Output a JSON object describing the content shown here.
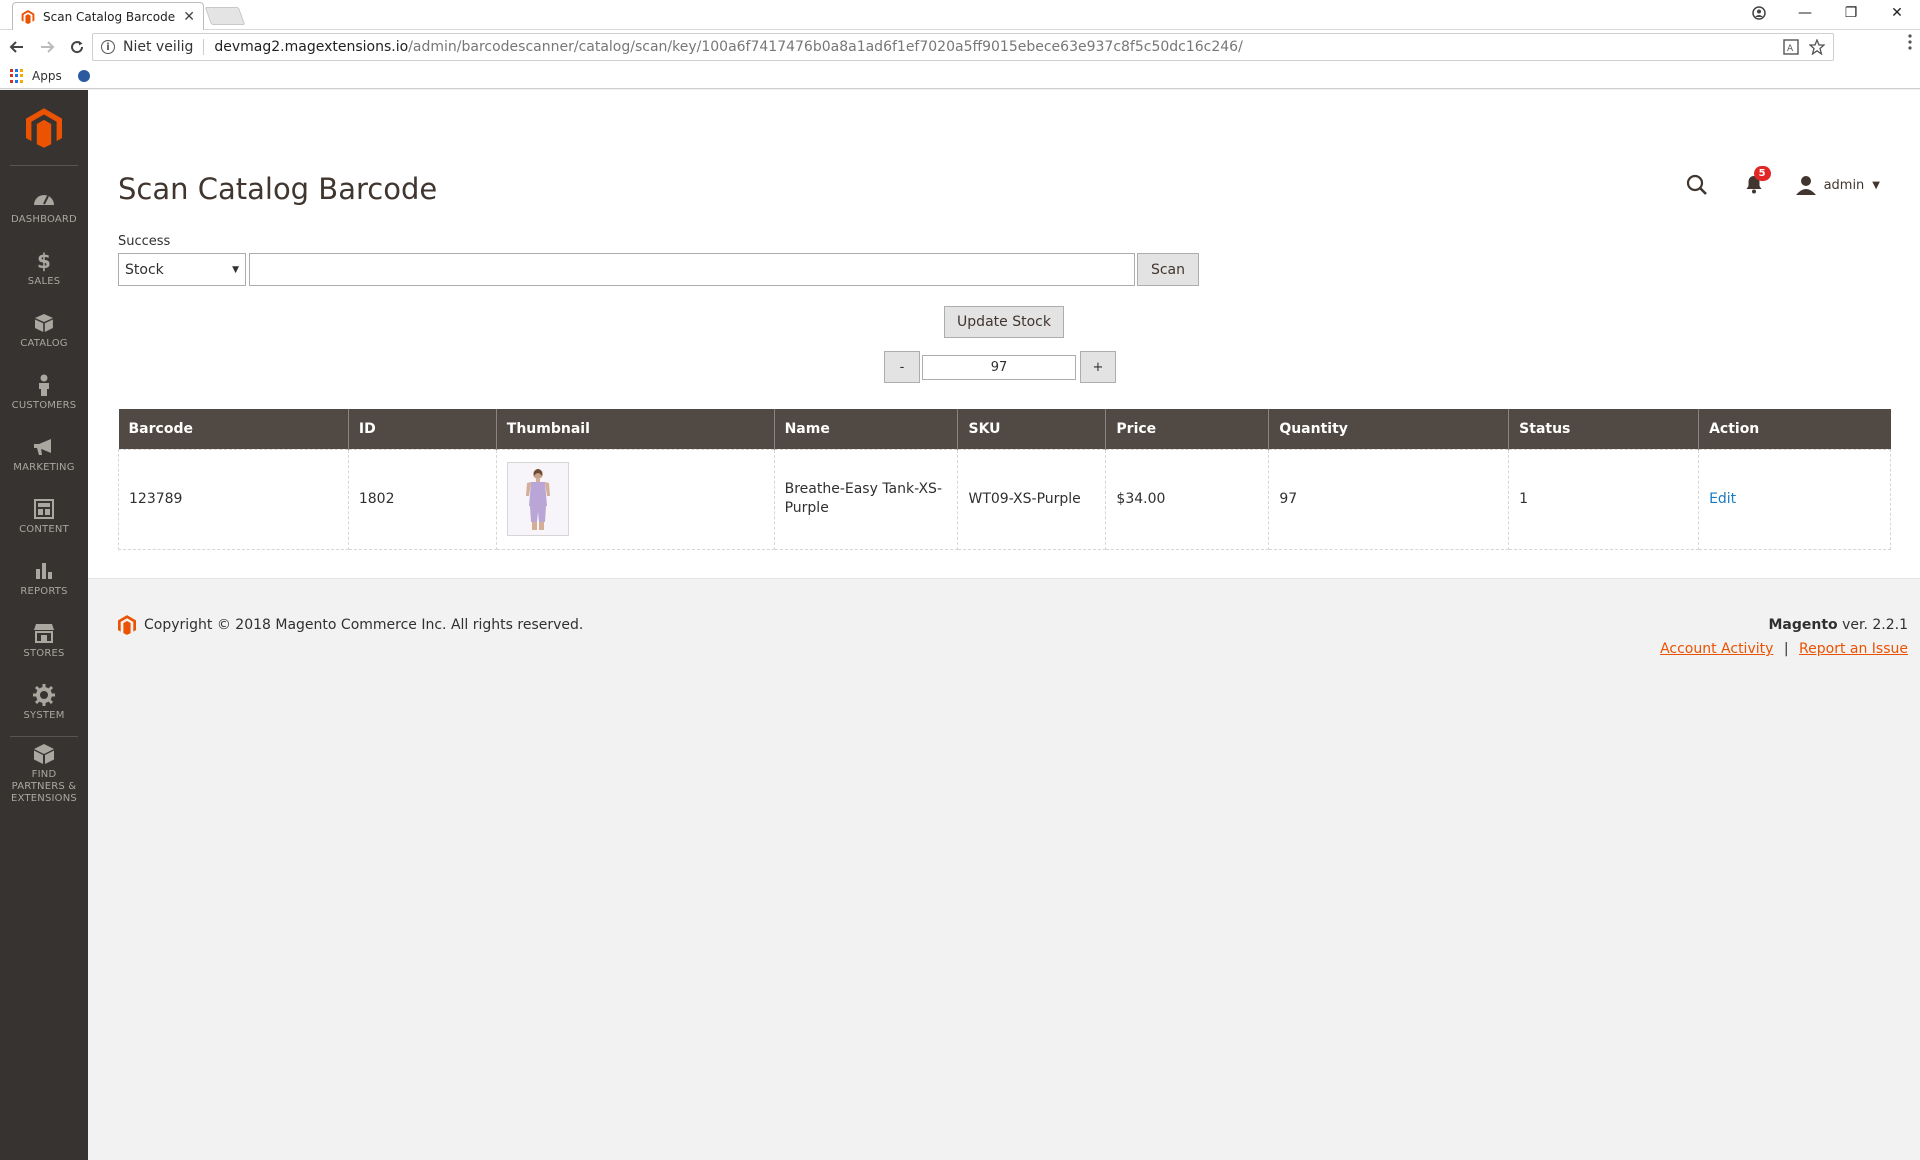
{
  "browser": {
    "tab_title": "Scan Catalog Barcode",
    "tab_close": "✕",
    "security_label": "Niet veilig",
    "url_domain": "devmag2.magextensions.io",
    "url_path": "/admin/barcodescanner/catalog/scan/key/100a6f7417476b0a8a1ad6f1ef7020a5ff9015ebece63e937c8f5c50dc16c246/",
    "bookmark_apps": "Apps",
    "win_minimize": "—",
    "win_restore": "❐",
    "win_close": "✕"
  },
  "sidebar": {
    "items": [
      {
        "label": "DASHBOARD",
        "icon": "dashboard-icon"
      },
      {
        "label": "SALES",
        "icon": "dollar-icon"
      },
      {
        "label": "CATALOG",
        "icon": "box-icon"
      },
      {
        "label": "CUSTOMERS",
        "icon": "person-icon"
      },
      {
        "label": "MARKETING",
        "icon": "megaphone-icon"
      },
      {
        "label": "CONTENT",
        "icon": "layout-icon"
      },
      {
        "label": "REPORTS",
        "icon": "bar-chart-icon"
      },
      {
        "label": "STORES",
        "icon": "store-icon"
      },
      {
        "label": "SYSTEM",
        "icon": "gear-icon"
      },
      {
        "label": "FIND PARTNERS & EXTENSIONS",
        "icon": "cube-icon"
      }
    ]
  },
  "header": {
    "page_title": "Scan Catalog Barcode",
    "notification_count": "5",
    "user_name": "admin"
  },
  "scan_form": {
    "status_message": "Success",
    "mode_selected": "Stock",
    "scan_value": "",
    "scan_button": "Scan",
    "update_button": "Update Stock",
    "minus_label": "-",
    "plus_label": "+",
    "quantity": "97"
  },
  "grid": {
    "columns": [
      "Barcode",
      "ID",
      "Thumbnail",
      "Name",
      "SKU",
      "Price",
      "Quantity",
      "Status",
      "Action"
    ],
    "rows": [
      {
        "barcode": "123789",
        "id": "1802",
        "name": "Breathe-Easy Tank-XS-Purple",
        "sku": "WT09-XS-Purple",
        "price": "$34.00",
        "quantity": "97",
        "status": "1",
        "action": "Edit"
      }
    ]
  },
  "footer": {
    "copyright": "Copyright © 2018 Magento Commerce Inc. All rights reserved.",
    "brand": "Magento",
    "version": " ver. 2.2.1",
    "link_activity": "Account Activity",
    "link_issue": "Report an Issue",
    "separator": "|"
  },
  "colors": {
    "sidebar_bg": "#373330",
    "grid_header_bg": "#514943",
    "accent": "#eb5202",
    "link": "#1979c3"
  }
}
